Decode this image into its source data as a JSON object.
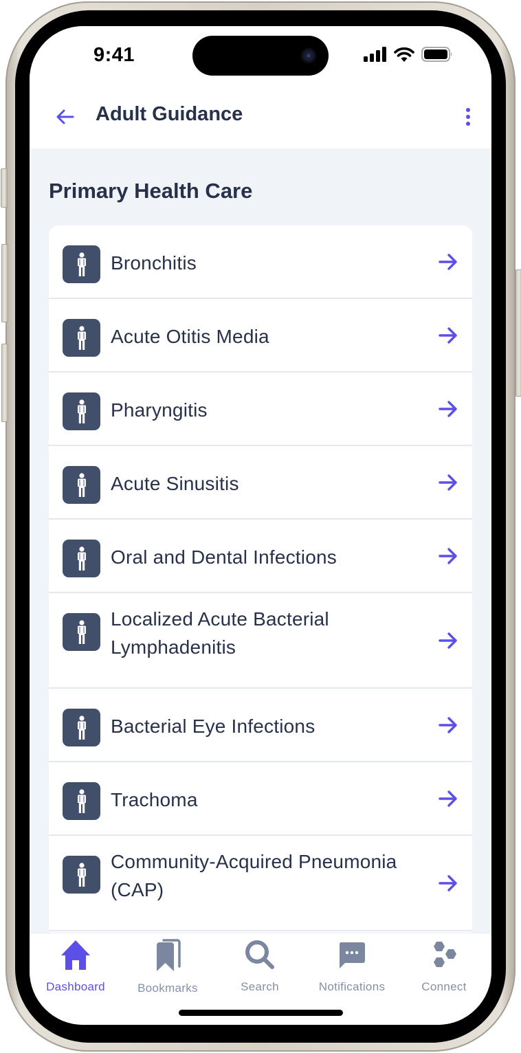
{
  "status_bar": {
    "time": "9:41",
    "icons": [
      "cellular-signal-icon",
      "wifi-icon",
      "battery-icon"
    ]
  },
  "header": {
    "back_icon": "arrow-left-icon",
    "title": "Adult Guidance",
    "menu_icon": "more-vertical-icon"
  },
  "section": {
    "title": "Primary Health Care",
    "items": [
      {
        "label": "Bronchitis",
        "icon": "person-icon",
        "lines": 1
      },
      {
        "label": "Acute Otitis Media",
        "icon": "person-icon",
        "lines": 1
      },
      {
        "label": "Pharyngitis",
        "icon": "person-icon",
        "lines": 1
      },
      {
        "label": "Acute Sinusitis",
        "icon": "person-icon",
        "lines": 1
      },
      {
        "label": "Oral and Dental Infections",
        "icon": "person-icon",
        "lines": 1
      },
      {
        "label": "Localized Acute Bacterial Lymphadenitis",
        "icon": "person-icon",
        "lines": 2
      },
      {
        "label": "Bacterial Eye Infections",
        "icon": "person-icon",
        "lines": 1
      },
      {
        "label": "Trachoma",
        "icon": "person-icon",
        "lines": 1
      },
      {
        "label": "Community-Acquired Pneumonia (CAP)",
        "icon": "person-icon",
        "lines": 2
      }
    ]
  },
  "tabbar": {
    "active": "Dashboard",
    "tabs": [
      {
        "label": "Dashboard",
        "icon": "home-icon"
      },
      {
        "label": "Bookmarks",
        "icon": "bookmarks-icon"
      },
      {
        "label": "Search",
        "icon": "search-icon"
      },
      {
        "label": "Notifications",
        "icon": "chat-bubble-icon"
      },
      {
        "label": "Connect",
        "icon": "hexagons-icon"
      }
    ]
  },
  "colors": {
    "accent": "#5b4fe8",
    "text_primary": "#27314a",
    "icon_tile": "#414f6b",
    "tab_inactive": "#8490a6",
    "background": "#f0f3f8"
  }
}
